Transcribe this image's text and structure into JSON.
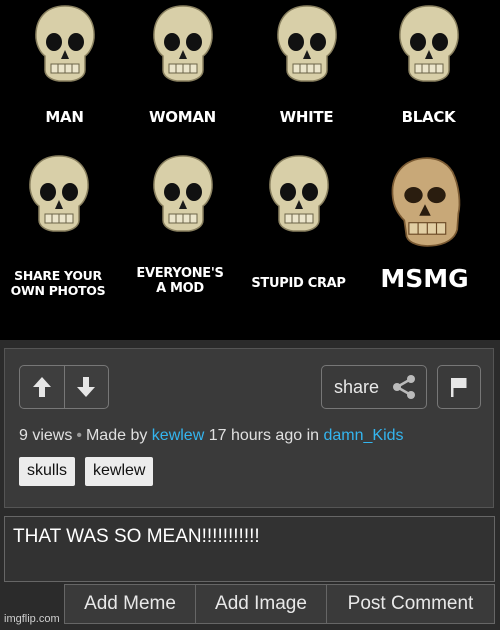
{
  "meme": {
    "captions": [
      "MAN",
      "WOMAN",
      "WHITE",
      "BLACK",
      "SHARE YOUR OWN PHOTOS",
      "EVERYONE'S A MOD",
      "STUPID CRAP",
      "MSMG"
    ]
  },
  "post": {
    "share_label": "share",
    "views": "9 views",
    "made_by_prefix": "Made by",
    "author": "kewlew",
    "time_text": "17 hours ago in",
    "stream": "damn_Kids",
    "tags": [
      "skulls",
      "kewlew"
    ]
  },
  "comment": {
    "text": "THAT WAS SO MEAN!!!!!!!!!!!"
  },
  "actions": {
    "add_meme": "Add Meme",
    "add_image": "Add Image",
    "post_comment": "Post Comment"
  },
  "watermark": "imgflip.com",
  "colors": {
    "link": "#34b5ef",
    "background": "#2b2b2b",
    "meme_bg": "#000000"
  }
}
